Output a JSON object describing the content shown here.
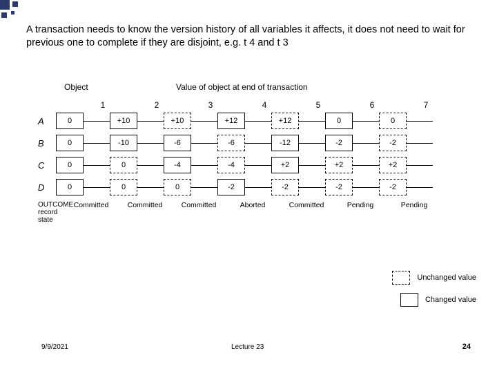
{
  "main_text": "A transaction needs to know the version history of all variables it affects, it does not need to wait for previous one to complete if they are disjoint, e.g. t 4 and t 3",
  "headers": {
    "object": "Object",
    "value": "Value of object at end of transaction",
    "cols": [
      "1",
      "2",
      "3",
      "4",
      "5",
      "6",
      "7"
    ]
  },
  "rows": [
    {
      "label": "A",
      "cells": [
        {
          "v": "0",
          "t": "solid"
        },
        {
          "v": "+10",
          "t": "solid"
        },
        {
          "v": "+10",
          "t": "dashed"
        },
        {
          "v": "+12",
          "t": "solid"
        },
        {
          "v": "+12",
          "t": "dashed"
        },
        {
          "v": "0",
          "t": "solid"
        },
        {
          "v": "0",
          "t": "dashed"
        }
      ]
    },
    {
      "label": "B",
      "cells": [
        {
          "v": "0",
          "t": "solid"
        },
        {
          "v": "-10",
          "t": "solid"
        },
        {
          "v": "-6",
          "t": "solid"
        },
        {
          "v": "-6",
          "t": "dashed"
        },
        {
          "v": "-12",
          "t": "solid"
        },
        {
          "v": "-2",
          "t": "solid"
        },
        {
          "v": "-2",
          "t": "dashed"
        }
      ]
    },
    {
      "label": "C",
      "cells": [
        {
          "v": "0",
          "t": "solid"
        },
        {
          "v": "0",
          "t": "dashed"
        },
        {
          "v": "-4",
          "t": "solid"
        },
        {
          "v": "-4",
          "t": "dashed"
        },
        {
          "v": "+2",
          "t": "solid"
        },
        {
          "v": "+2",
          "t": "dashed"
        },
        {
          "v": "+2",
          "t": "dashed"
        }
      ]
    },
    {
      "label": "D",
      "cells": [
        {
          "v": "0",
          "t": "solid"
        },
        {
          "v": "0",
          "t": "dashed"
        },
        {
          "v": "0",
          "t": "dashed"
        },
        {
          "v": "-2",
          "t": "solid"
        },
        {
          "v": "-2",
          "t": "dashed"
        },
        {
          "v": "-2",
          "t": "dashed"
        },
        {
          "v": "-2",
          "t": "dashed"
        }
      ]
    }
  ],
  "outcome": {
    "label": "OUTCOME record state",
    "values": [
      "Committed",
      "Committed",
      "Committed",
      "Aborted",
      "Committed",
      "Pending",
      "Pending"
    ]
  },
  "legend": {
    "unchanged": "Unchanged value",
    "changed": "Changed value"
  },
  "footer": {
    "date": "9/9/2021",
    "lecture": "Lecture 23",
    "page": "24"
  }
}
